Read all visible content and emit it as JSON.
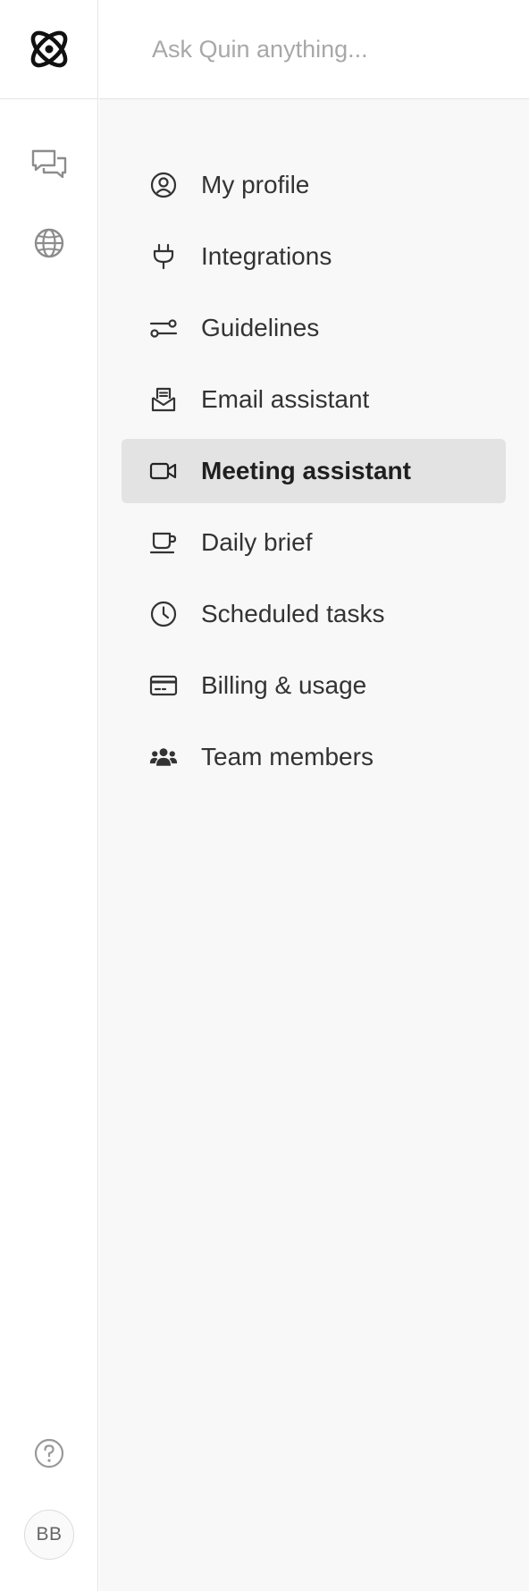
{
  "app": {
    "accent_color": "#111111",
    "logo_icon": "atom-logo-icon"
  },
  "search": {
    "placeholder": "Ask Quin anything..."
  },
  "rail": {
    "items": [
      {
        "icon": "chat-bubbles-icon"
      },
      {
        "icon": "globe-icon"
      }
    ],
    "help_icon": "help-circle-icon",
    "avatar_initials": "BB"
  },
  "settings_menu": {
    "active_index": 4,
    "active_background": "#e3e3e3",
    "items": [
      {
        "label": "My profile",
        "icon": "user-circle-icon"
      },
      {
        "label": "Integrations",
        "icon": "plug-icon"
      },
      {
        "label": "Guidelines",
        "icon": "sliders-icon"
      },
      {
        "label": "Email assistant",
        "icon": "mail-inbox-icon"
      },
      {
        "label": "Meeting assistant",
        "icon": "video-camera-icon"
      },
      {
        "label": "Daily brief",
        "icon": "coffee-cup-icon"
      },
      {
        "label": "Scheduled tasks",
        "icon": "clock-icon"
      },
      {
        "label": "Billing & usage",
        "icon": "credit-card-icon"
      },
      {
        "label": "Team members",
        "icon": "users-icon"
      }
    ]
  }
}
